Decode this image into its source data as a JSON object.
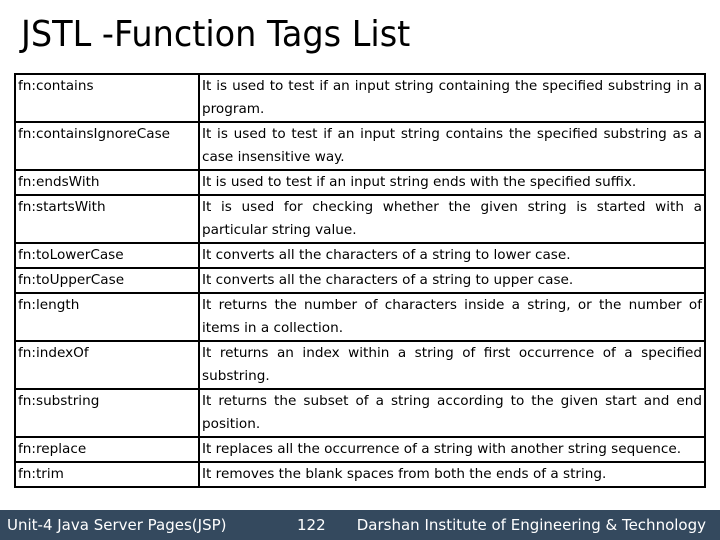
{
  "slide": {
    "title": "JSTL -Function Tags List"
  },
  "table": {
    "rows": [
      {
        "name": "fn:contains",
        "description": "It is used to test if an input string containing the specified substring in a program."
      },
      {
        "name": "fn:containsIgnoreCase",
        "description": "It is used to test if an input string contains the specified substring as a case insensitive way."
      },
      {
        "name": "fn:endsWith",
        "description": "It is used to test if an input string ends with the specified suffix."
      },
      {
        "name": "fn:startsWith",
        "description": "It is used for checking whether the given string is started with a particular string value."
      },
      {
        "name": "fn:toLowerCase",
        "description": "It converts all the characters of a string to lower case."
      },
      {
        "name": "fn:toUpperCase",
        "description": "It converts all the characters of a string to upper case."
      },
      {
        "name": "fn:length",
        "description": "It returns the number of characters inside a string, or the number of items in a collection."
      },
      {
        "name": "fn:indexOf",
        "description": "It returns an index within a string of first occurrence of a specified substring."
      },
      {
        "name": "fn:substring",
        "description": "It returns the subset of a string according to the given start and end position."
      },
      {
        "name": "fn:replace",
        "description": "It replaces all the occurrence of a string with another string sequence."
      },
      {
        "name": "fn:trim",
        "description": "It removes the blank spaces from both the ends of a string."
      }
    ]
  },
  "footer": {
    "unit": "Unit-4 Java Server Pages(JSP)",
    "page_number": "122",
    "institute": "Darshan Institute of Engineering & Technology",
    "background_color": "#34495e"
  }
}
